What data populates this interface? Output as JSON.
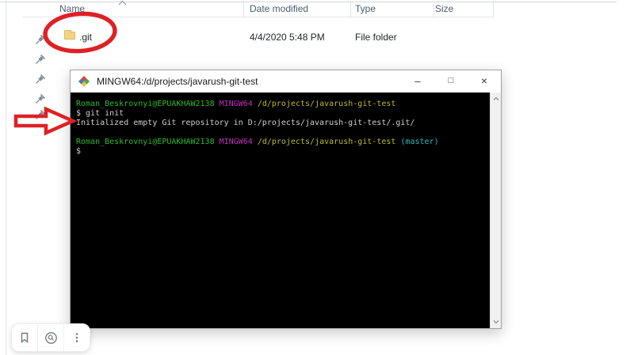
{
  "explorer": {
    "columns": [
      "Name",
      "Date modified",
      "Type",
      "Size"
    ],
    "sort": {
      "column": "Name",
      "direction": "ascending"
    },
    "file_row": {
      "name": ".git",
      "date_modified": "4/4/2020 5:48 PM",
      "type": "File folder",
      "size": ""
    },
    "pinned_item_count": 5
  },
  "terminal": {
    "title": "MINGW64:/d/projects/javarush-git-test",
    "window_controls": {
      "minimize": "–",
      "maximize": "□",
      "close": "×"
    },
    "colors": {
      "bg": "#000000",
      "fg": "#cfcfcf",
      "green": "#2dbb2d",
      "magenta": "#bf2ebf",
      "yellow": "#bcbc28",
      "cyan": "#2dbcbc"
    },
    "lines": [
      [
        {
          "color": "green",
          "text": "Roman_Beskrovnyi@EPUAKHAW2138"
        },
        {
          "color": "fg",
          "text": " "
        },
        {
          "color": "magenta",
          "text": "MINGW64"
        },
        {
          "color": "fg",
          "text": " "
        },
        {
          "color": "yellow",
          "text": "/d/projects/javarush-git-test"
        }
      ],
      [
        {
          "color": "fg",
          "text": "$ git init"
        }
      ],
      [
        {
          "color": "fg",
          "text": "Initialized empty Git repository in D:/projects/javarush-git-test/.git/"
        }
      ],
      [],
      [
        {
          "color": "green",
          "text": "Roman_Beskrovnyi@EPUAKHAW2138"
        },
        {
          "color": "fg",
          "text": " "
        },
        {
          "color": "magenta",
          "text": "MINGW64"
        },
        {
          "color": "fg",
          "text": " "
        },
        {
          "color": "yellow",
          "text": "/d/projects/javarush-git-test"
        },
        {
          "color": "cyan",
          "text": " (master)"
        }
      ],
      [
        {
          "color": "fg",
          "text": "$"
        }
      ]
    ]
  },
  "annotations": {
    "highlight_color": "#de2125"
  },
  "overlay_toolbar": {
    "icons": [
      "bookmark",
      "search-lens",
      "more-options"
    ]
  }
}
